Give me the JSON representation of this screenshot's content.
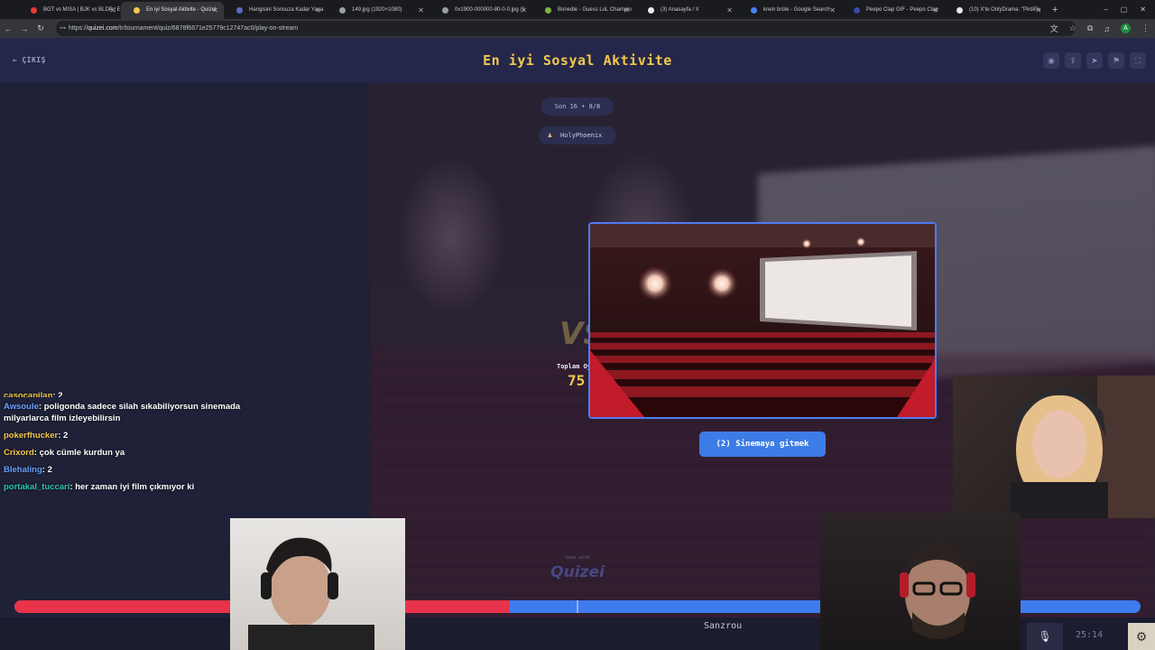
{
  "browser": {
    "tabs": [
      {
        "title": "BGT vs MISA | BJK vs BLDP | E",
        "color": "#e53935"
      },
      {
        "title": "En iyi Sosyal Aktivite - Quizei",
        "color": "#f5c84c",
        "active": true
      },
      {
        "title": "Hangisini Sonsuza Kadar Yaşa",
        "color": "#5c6bc0"
      },
      {
        "title": "149.jpg (1920×1080)",
        "color": "#9aa0a6"
      },
      {
        "title": "0x1900-000000-80-0-0.jpg (1",
        "color": "#9aa0a6"
      },
      {
        "title": "Bonedle - Guess LoL Champio",
        "color": "#7cb342"
      },
      {
        "title": "(3) Anasayfa / X",
        "color": "#e8eaed"
      },
      {
        "title": "krem brüle - Google Search",
        "color": "#4285f4"
      },
      {
        "title": "Peepo Clap GIF - Peepo Clap",
        "color": "#3949ab"
      },
      {
        "title": "(10) X'te OnlyDrama: \"PirdiPu",
        "color": "#e8eaed"
      }
    ],
    "url_host": "quizei.com",
    "url_path": "/tr/tournament/quiz/6878f6671e25779c12747ac0/play-on-stream",
    "url_prefix": "https://",
    "profile_initial": "A"
  },
  "header": {
    "exit_label": "ÇIKIŞ",
    "title": "En iyi Sosyal Aktivite"
  },
  "game": {
    "round": "Son 16 • 8/8",
    "player": "HolyPhoenix",
    "total_votes_label": "Toplam Oy",
    "total_votes": "75",
    "choice_label": "(2) Sinemaya gitmek",
    "made_with": "made with",
    "brand": "Quizei",
    "vote_share_red": 0.44
  },
  "chat": {
    "messages": [
      {
        "user": "casocapilan",
        "text": "2",
        "color": "#f5c84c",
        "cut": true
      },
      {
        "user": "Awsoule",
        "text": "poligonda sadece silah sıkabiliyorsun sinemada milyarlarca film izleyebilirsin",
        "color": "#6aa0ff"
      },
      {
        "user": "pokerfhucker",
        "text": "2",
        "color": "#f5c84c"
      },
      {
        "user": "Crixord",
        "text": "çok cümle kurdun ya",
        "color": "#f5c84c"
      },
      {
        "user": "Blehaling",
        "text": "2",
        "color": "#6aa0ff"
      },
      {
        "user": "portakal_tuccari",
        "text": "her zaman iyi film çıkmıyor ki",
        "color": "#2ec4b6"
      }
    ]
  },
  "stream": {
    "bottom_name": "Sanzrou",
    "timer": "25:14"
  }
}
